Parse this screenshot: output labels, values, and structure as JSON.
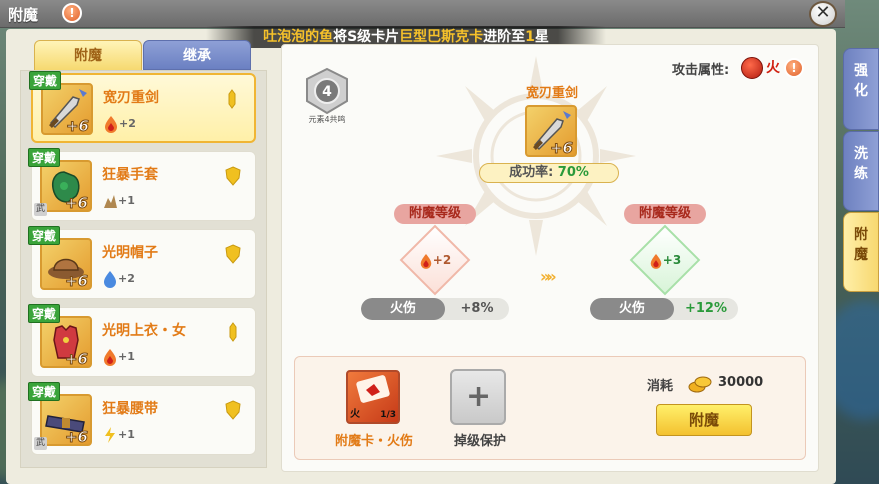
{
  "window": {
    "title": "附魔",
    "info_icon": "!",
    "close_icon": "✕"
  },
  "marquee": {
    "user": "吐泡泡的鱼",
    "mid1": "将S级卡片",
    "card": "巨型巴斯克卡",
    "mid2": "进阶至",
    "stars": "1",
    "suffix": "星"
  },
  "left_tabs": [
    "附魔",
    "继承"
  ],
  "items": [
    {
      "badge": "穿戴",
      "name": "宽刃重剑",
      "plus": "+6",
      "bonus": "+2",
      "bonus_icon": "fire-drop-icon",
      "mark": "sword-pin-icon",
      "selected": true,
      "equip_tag": ""
    },
    {
      "badge": "穿戴",
      "name": "狂暴手套",
      "plus": "+6",
      "bonus": "+1",
      "bonus_icon": "earth-spike-icon",
      "mark": "shield-icon",
      "selected": false,
      "equip_tag": "武"
    },
    {
      "badge": "穿戴",
      "name": "光明帽子",
      "plus": "+6",
      "bonus": "+2",
      "bonus_icon": "water-drop-icon",
      "mark": "shield-icon",
      "selected": false,
      "equip_tag": ""
    },
    {
      "badge": "穿戴",
      "name": "光明上衣・女",
      "plus": "+6",
      "bonus": "+1",
      "bonus_icon": "fire-drop-icon",
      "mark": "sword-pin-icon",
      "selected": false,
      "equip_tag": ""
    },
    {
      "badge": "穿戴",
      "name": "狂暴腰带",
      "plus": "+6",
      "bonus": "+1",
      "bonus_icon": "wind-icon",
      "mark": "shield-icon",
      "selected": false,
      "equip_tag": "武"
    }
  ],
  "main": {
    "attack_attr_label": "攻击属性:",
    "attr_value": "火",
    "stack_badge_num": "4",
    "stack_badge_text": "元素4共鸣",
    "weapon_name": "宽刃重剑",
    "weapon_plus": "+6",
    "success_label": "成功率:",
    "success_rate": "70%",
    "current": {
      "title": "附魔等级",
      "level": "+2",
      "stat_label": "火伤",
      "stat_value": "+8%"
    },
    "next": {
      "title": "附魔等级",
      "level": "+3",
      "stat_label": "火伤",
      "stat_value": "+12%"
    },
    "arrows": "»»",
    "card": {
      "label": "附魔卡・火伤",
      "element": "火",
      "count": "1/3"
    },
    "protect_label": "掉级保护",
    "cost_label": "消耗",
    "cost_value": "30000",
    "enchant_button": "附魔"
  },
  "right_tabs": [
    {
      "label": "强化",
      "active": false
    },
    {
      "label": "洗练",
      "active": false
    },
    {
      "label": "附魔",
      "active": true
    }
  ],
  "colors": {
    "accent_orange": "#e27b17",
    "success_green": "#2a9a3a",
    "fire_red": "#d02010",
    "tab_blue": "#6e81c0",
    "tab_gold": "#f7d870"
  }
}
